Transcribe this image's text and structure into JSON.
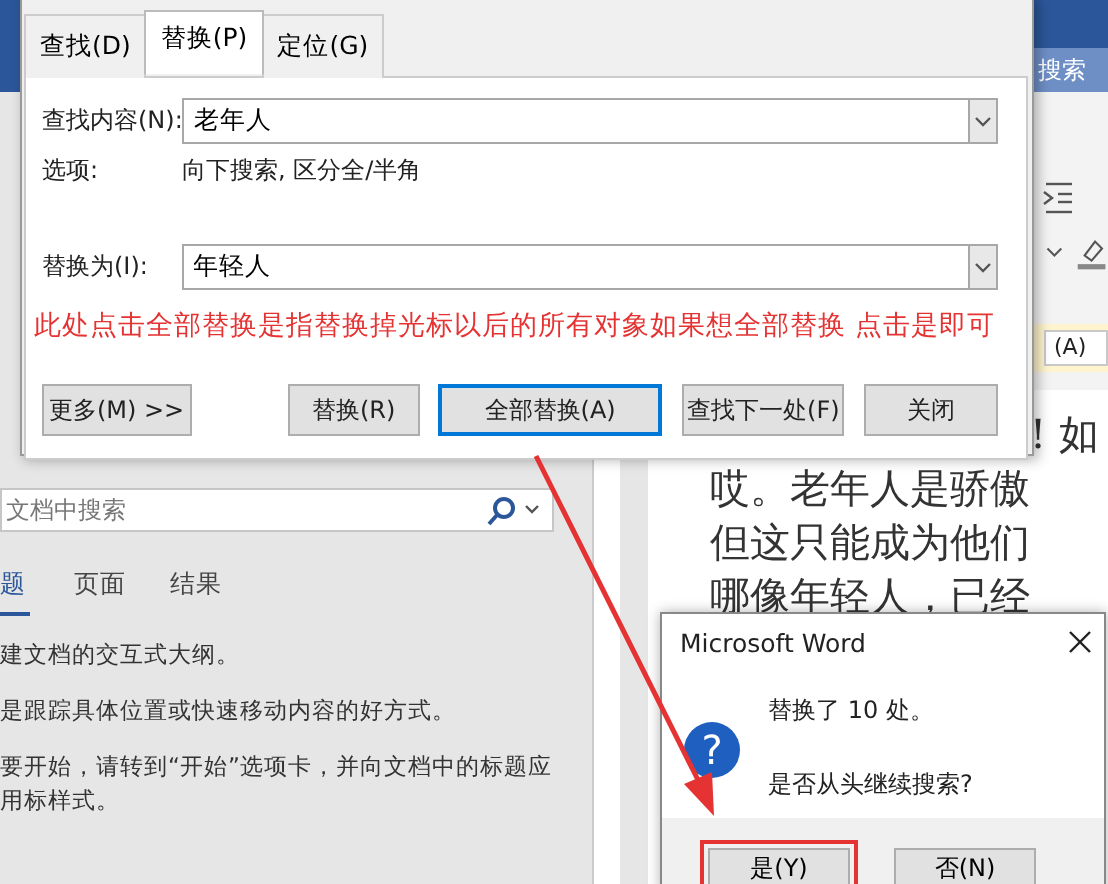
{
  "word_window": {
    "ribbon_search": "搜索",
    "ribbon_field_fragment": "(A)",
    "nav_pane": {
      "search_placeholder": "文档中搜索",
      "tabs": [
        {
          "label": "题",
          "selected": true
        },
        {
          "label": "页面",
          "selected": false
        },
        {
          "label": "结果",
          "selected": false
        }
      ],
      "paragraphs": [
        "建文档的交互式大纲。",
        "是跟踪具体位置或快速移动内容的好方式。",
        "要开始，请转到“开始”选项卡，并向文档中的标题应用标样式。"
      ]
    },
    "document_lines": [
      "! 如",
      "哎。老年人是骄傲",
      "但这只能成为他们",
      "哪像年轻人，已经"
    ]
  },
  "find_dialog": {
    "tabs": [
      {
        "label": "查找(D)",
        "selected": false
      },
      {
        "label": "替换(P)",
        "selected": true
      },
      {
        "label": "定位(G)",
        "selected": false
      }
    ],
    "find_what": {
      "label": "查找内容(N):",
      "value": "老年人"
    },
    "options": {
      "label": "选项:",
      "value": "向下搜索, 区分全/半角"
    },
    "replace_with": {
      "label": "替换为(I):",
      "value": "年轻人"
    },
    "annotation": "此处点击全部替换是指替换掉光标以后的所有对象如果想全部替换 点击是即可",
    "buttons": [
      {
        "label": "更多(M) >>",
        "default": false
      },
      {
        "label": "替换(R)",
        "default": false
      },
      {
        "label": "全部替换(A)",
        "default": true
      },
      {
        "label": "查找下一处(F)",
        "default": false
      },
      {
        "label": "关闭",
        "default": false
      }
    ]
  },
  "message_box": {
    "title": "Microsoft Word",
    "icon_glyph": "?",
    "lines": [
      "替换了 10 处。",
      "是否从头继续搜索?"
    ],
    "buttons": [
      {
        "label": "是(Y)",
        "highlighted": true
      },
      {
        "label": "否(N)",
        "highlighted": false
      }
    ]
  }
}
